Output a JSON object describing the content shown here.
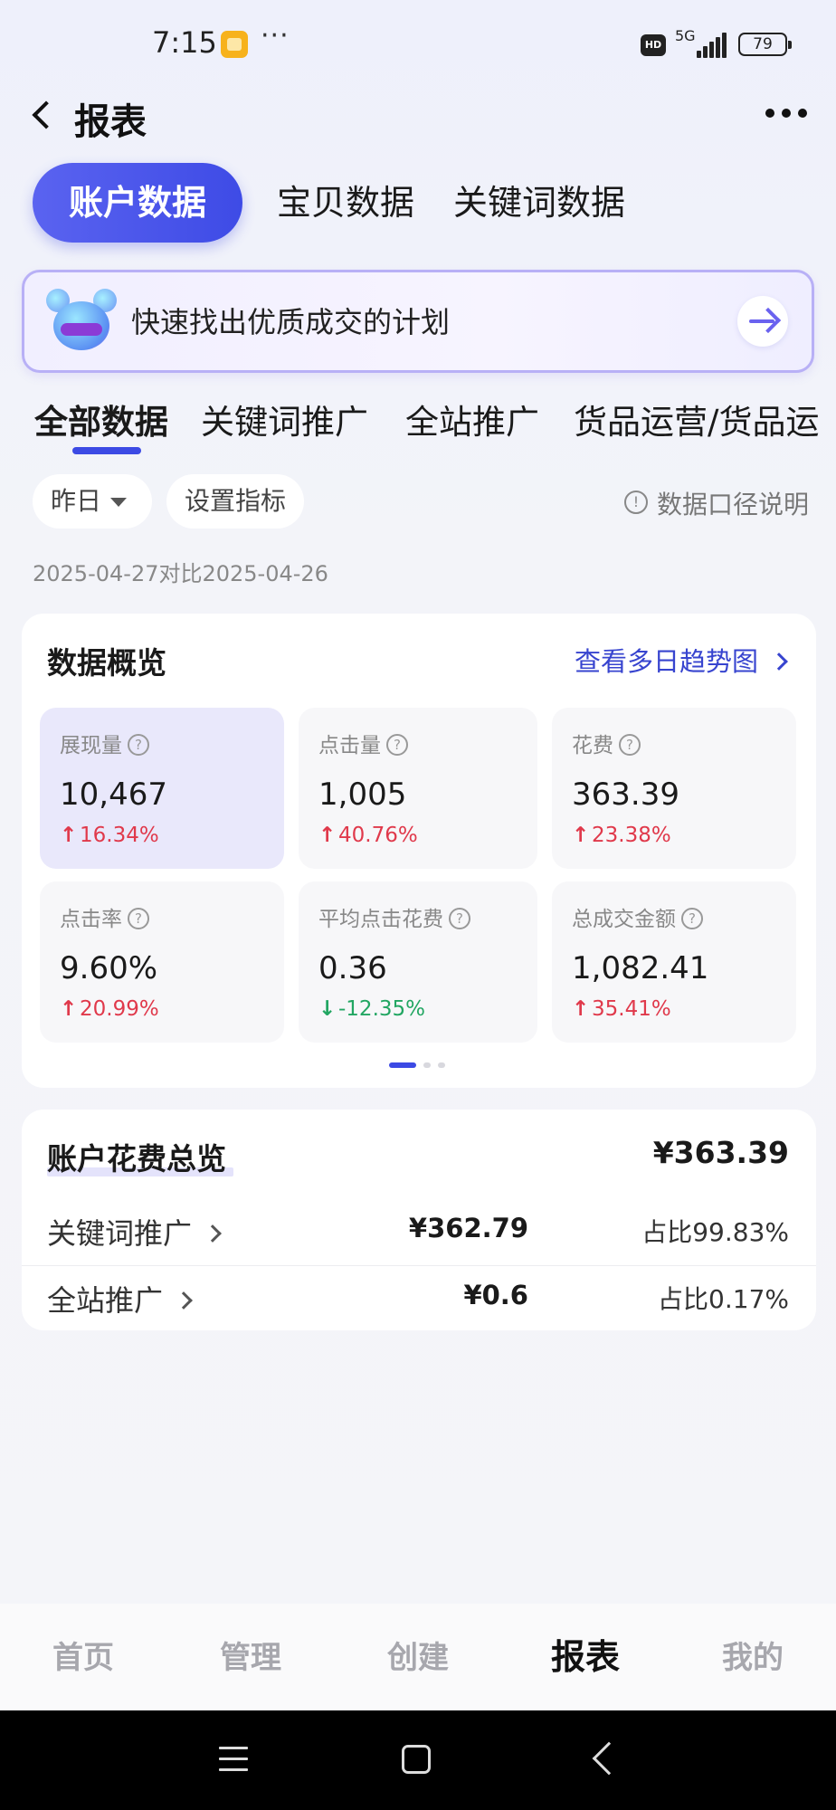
{
  "status_bar": {
    "time": "7:15",
    "dots": "···",
    "hd": "HD",
    "network": "5G",
    "battery": "79"
  },
  "header": {
    "title": "报表"
  },
  "top_tabs": [
    "账户数据",
    "宝贝数据",
    "关键词数据"
  ],
  "banner": {
    "text": "快速找出优质成交的计划"
  },
  "sub_tabs": [
    "全部数据",
    "关键词推广",
    "全站推广",
    "货品运营/货品运"
  ],
  "filters": {
    "date": "昨日",
    "set_metrics": "设置指标",
    "caliber": "数据口径说明"
  },
  "date_compare": "2025-04-27对比2025-04-26",
  "overview": {
    "title": "数据概览",
    "trend_link": "查看多日趋势图",
    "metrics": [
      {
        "label": "展现量",
        "value": "10,467",
        "change": "16.34%",
        "direction": "up"
      },
      {
        "label": "点击量",
        "value": "1,005",
        "change": "40.76%",
        "direction": "up"
      },
      {
        "label": "花费",
        "value": "363.39",
        "change": "23.38%",
        "direction": "up"
      },
      {
        "label": "点击率",
        "value": "9.60%",
        "change": "20.99%",
        "direction": "up"
      },
      {
        "label": "平均点击花费",
        "value": "0.36",
        "change": "-12.35%",
        "direction": "down"
      },
      {
        "label": "总成交金额",
        "value": "1,082.41",
        "change": "35.41%",
        "direction": "up"
      }
    ]
  },
  "spend": {
    "title": "账户花费总览",
    "total": "¥363.39",
    "rows": [
      {
        "label": "关键词推广",
        "amount": "¥362.79",
        "share": "占比99.83%"
      },
      {
        "label": "全站推广",
        "amount": "¥0.6",
        "share": "占比0.17%"
      }
    ]
  },
  "bottom_nav": [
    "首页",
    "管理",
    "创建",
    "报表",
    "我的"
  ],
  "colors": {
    "accent": "#3e4be6",
    "up": "#e0394b",
    "down": "#22a662",
    "link": "#3744cf"
  }
}
